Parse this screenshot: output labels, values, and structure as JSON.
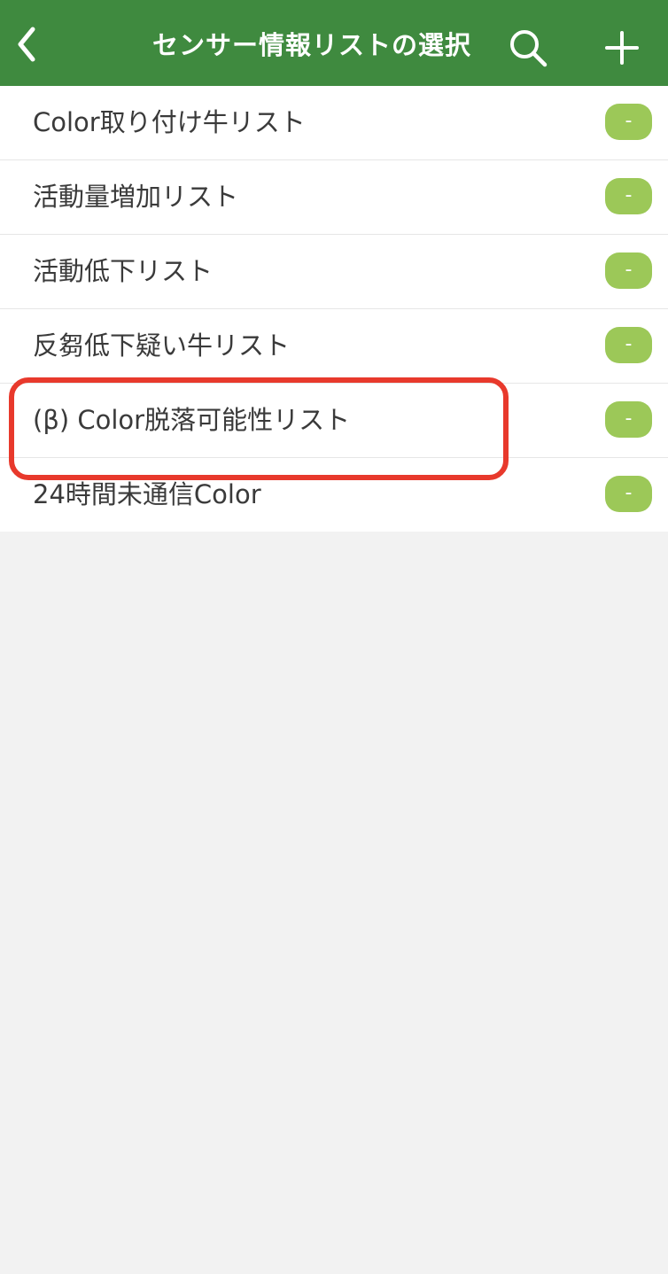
{
  "header": {
    "title": "センサー情報リストの選択",
    "back_icon": "chevron-left-icon",
    "search_icon": "search-icon",
    "add_icon": "plus-icon"
  },
  "list": {
    "items": [
      {
        "label": "Color取り付け牛リスト",
        "button": "-"
      },
      {
        "label": "活動量増加リスト",
        "button": "-"
      },
      {
        "label": "活動低下リスト",
        "button": "-"
      },
      {
        "label": "反芻低下疑い牛リスト",
        "button": "-"
      },
      {
        "label": "(β) Color脱落可能性リスト",
        "button": "-"
      },
      {
        "label": "24時間未通信Color",
        "button": "-"
      }
    ]
  },
  "colors": {
    "header_bg": "#3f8a3f",
    "pill_bg": "#9cc858",
    "highlight": "#e8392c",
    "background": "#f2f2f2"
  }
}
